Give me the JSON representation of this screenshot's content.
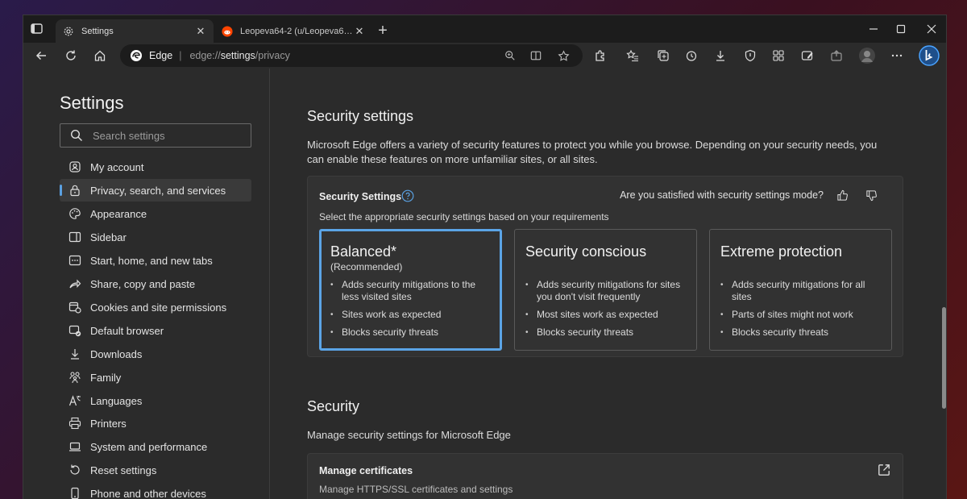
{
  "browser": {
    "tabs": [
      {
        "title": "Settings",
        "active": true
      },
      {
        "title": "Leopeva64-2 (u/Leopeva64-2) - Reddit",
        "active": false
      }
    ],
    "address": {
      "brand": "Edge",
      "url_protocol": "edge://",
      "url_path": "settings",
      "url_rest": "/privacy"
    },
    "accent_color": "#5ba4e6"
  },
  "sidebar": {
    "title": "Settings",
    "search_placeholder": "Search settings",
    "items": [
      {
        "label": "My account",
        "icon": "account-icon"
      },
      {
        "label": "Privacy, search, and services",
        "icon": "lock-icon",
        "selected": true
      },
      {
        "label": "Appearance",
        "icon": "palette-icon"
      },
      {
        "label": "Sidebar",
        "icon": "sidebar-icon"
      },
      {
        "label": "Start, home, and new tabs",
        "icon": "home-tabs-icon"
      },
      {
        "label": "Share, copy and paste",
        "icon": "share-icon"
      },
      {
        "label": "Cookies and site permissions",
        "icon": "cookies-icon"
      },
      {
        "label": "Default browser",
        "icon": "default-browser-icon"
      },
      {
        "label": "Downloads",
        "icon": "download-icon"
      },
      {
        "label": "Family",
        "icon": "family-icon"
      },
      {
        "label": "Languages",
        "icon": "languages-icon"
      },
      {
        "label": "Printers",
        "icon": "printer-icon"
      },
      {
        "label": "System and performance",
        "icon": "laptop-icon"
      },
      {
        "label": "Reset settings",
        "icon": "reset-icon"
      },
      {
        "label": "Phone and other devices",
        "icon": "phone-icon"
      }
    ]
  },
  "main": {
    "security_settings": {
      "heading": "Security settings",
      "description": "Microsoft Edge offers a variety of security features to protect you while you browse. Depending on your security needs, you can enable these features on more unfamiliar sites, or all sites.",
      "card_title": "Security Settings",
      "feedback_question": "Are you satisfied with security settings mode?",
      "card_subtitle": "Select the appropriate security settings based on your requirements",
      "modes": [
        {
          "title": "Balanced*",
          "subtitle": "(Recommended)",
          "selected": true,
          "bullets": [
            "Adds security mitigations to the less visited sites",
            "Sites work as expected",
            "Blocks security threats"
          ]
        },
        {
          "title": "Security conscious",
          "selected": false,
          "bullets": [
            "Adds security mitigations for sites you don't visit frequently",
            "Most sites work as expected",
            "Blocks security threats"
          ]
        },
        {
          "title": "Extreme protection",
          "selected": false,
          "bullets": [
            "Adds security mitigations for all sites",
            "Parts of sites might not work",
            "Blocks security threats"
          ]
        }
      ]
    },
    "security": {
      "heading": "Security",
      "description": "Manage security settings for Microsoft Edge",
      "manage_certificates": {
        "title": "Manage certificates",
        "subtitle": "Manage HTTPS/SSL certificates and settings"
      }
    }
  }
}
